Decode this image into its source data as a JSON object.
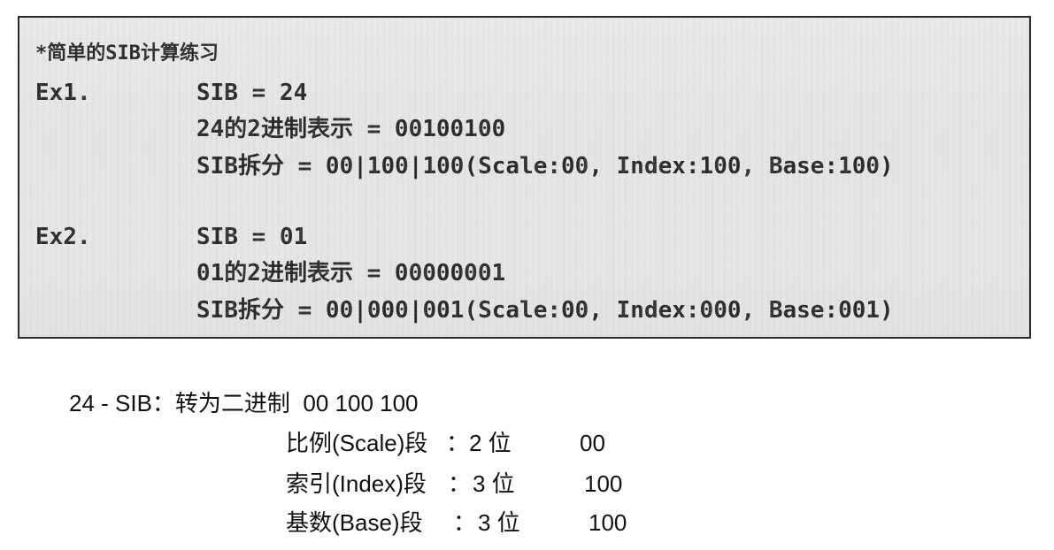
{
  "scan": {
    "title": "*简单的SIB计算练习",
    "examples": [
      {
        "label": "Ex1.",
        "lines": [
          "SIB = 24",
          "24的2进制表示 = 00100100",
          "SIB拆分 = 00|100|100(Scale:00, Index:100, Base:100)"
        ]
      },
      {
        "label": "Ex2.",
        "lines": [
          "SIB = 01",
          "01的2进制表示 = 00000001",
          "SIB拆分 = 00|000|001(Scale:00, Index:000, Base:001)"
        ]
      }
    ]
  },
  "notes": {
    "summary": "24 - SIB：转为二进制  00 100 100",
    "fields": [
      {
        "name": "比例(Scale)段",
        "sep": "：",
        "bits": "2 位",
        "value": "00"
      },
      {
        "name": "索引(Index)段",
        "sep": "：",
        "bits": "3 位",
        "value": "100"
      },
      {
        "name": "基数(Base)段",
        "sep": "：",
        "bits": "3 位",
        "value": "100"
      }
    ]
  }
}
